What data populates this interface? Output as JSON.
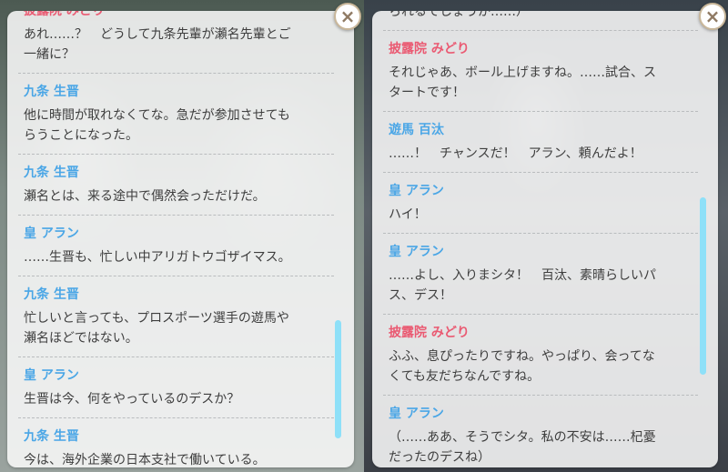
{
  "left_panel": {
    "partial_top": {
      "speaker": "披露院 みどり",
      "lines": [
        "あれ……？　どうして九条先輩が瀬名先輩とご",
        "一緒に？"
      ]
    },
    "entries": [
      {
        "speaker": "九条 生晋",
        "color": "blue",
        "lines": [
          "他に時間が取れなくてな。急だが参加させても",
          "らうことになった。"
        ]
      },
      {
        "speaker": "九条 生晋",
        "color": "blue",
        "lines": [
          "瀬名とは、来る途中で偶然会っただけだ。"
        ]
      },
      {
        "speaker": "皇 アラン",
        "color": "blue",
        "lines": [
          "……生晋も、忙しい中アリガトウゴザイマス。"
        ]
      },
      {
        "speaker": "九条 生晋",
        "color": "blue",
        "lines": [
          "忙しいと言っても、プロスポーツ選手の遊馬や",
          "瀬名ほどではない。"
        ]
      },
      {
        "speaker": "皇 アラン",
        "color": "blue",
        "lines": [
          "生晋は今、何をやっているのデスか？"
        ]
      },
      {
        "speaker": "九条 生晋",
        "color": "blue",
        "lines": [
          "今は、海外企業の日本支社で働いている。"
        ]
      }
    ],
    "scroll_position": 0.85
  },
  "right_panel": {
    "partial_top": {
      "lines": [
        "られるでしょうか……）"
      ]
    },
    "entries": [
      {
        "speaker": "披露院 みどり",
        "color": "pink",
        "lines": [
          "それじゃあ、ボール上げますね。……試合、ス",
          "タートです！"
        ]
      },
      {
        "speaker": "遊馬 百汰",
        "color": "blue",
        "lines": [
          "……！　チャンスだ！　アラン、頼んだよ！"
        ]
      },
      {
        "speaker": "皇 アラン",
        "color": "blue",
        "lines": [
          "ハイ！"
        ]
      },
      {
        "speaker": "皇 アラン",
        "color": "blue",
        "lines": [
          "……よし、入りまシタ！　百汰、素晴らしいパ",
          "ス、デス！"
        ]
      },
      {
        "speaker": "披露院 みどり",
        "color": "pink",
        "lines": [
          "ふふ、息ぴったりですね。やっぱり、会ってな",
          "くても友だちなんですね。"
        ]
      },
      {
        "speaker": "皇 アラン",
        "color": "blue",
        "lines": [
          "（……ああ、そうでシタ。私の不安は……杞憂",
          "だったのデスね）"
        ]
      }
    ],
    "scroll_position": 0.55
  },
  "close_button": {
    "glyph": "×"
  },
  "colors": {
    "speaker_blue": "#4aa6e6",
    "speaker_pink": "#ea5a72",
    "scroll_thumb": "#8ee0f8"
  }
}
